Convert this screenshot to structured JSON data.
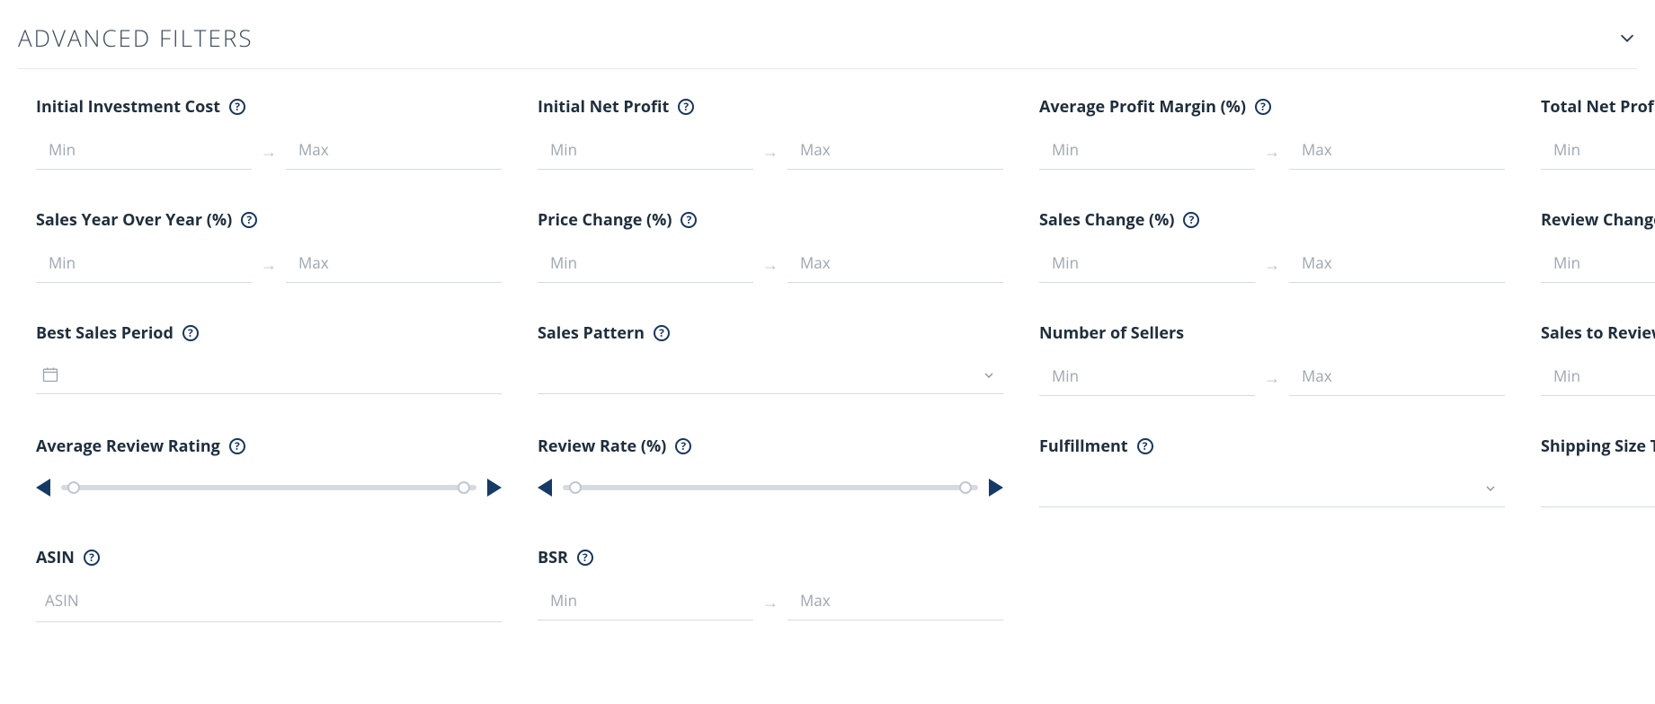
{
  "header": {
    "title": "ADVANCED FILTERS"
  },
  "placeholders": {
    "min": "Min",
    "max": "Max",
    "asin": "ASIN"
  },
  "labels": {
    "initialInvestment": "Initial Investment Cost",
    "initialNetProfit": "Initial Net Profit",
    "avgProfitMargin": "Average Profit Margin (%)",
    "totalNetProfit": "Total Net Profit",
    "salesYoY": "Sales Year Over Year (%)",
    "priceChange": "Price Change (%)",
    "salesChange": "Sales Change (%)",
    "reviewChange": "Review Change",
    "bestSalesPeriod": "Best Sales Period",
    "salesPattern": "Sales Pattern",
    "numberOfSellers": "Number of Sellers",
    "salesToReviews": "Sales to Reviews",
    "avgReviewRating": "Average Review Rating",
    "reviewRate": "Review Rate (%)",
    "fulfillment": "Fulfillment",
    "shippingSizeTier": "Shipping Size Tier",
    "asin": "ASIN",
    "bsr": "BSR"
  }
}
